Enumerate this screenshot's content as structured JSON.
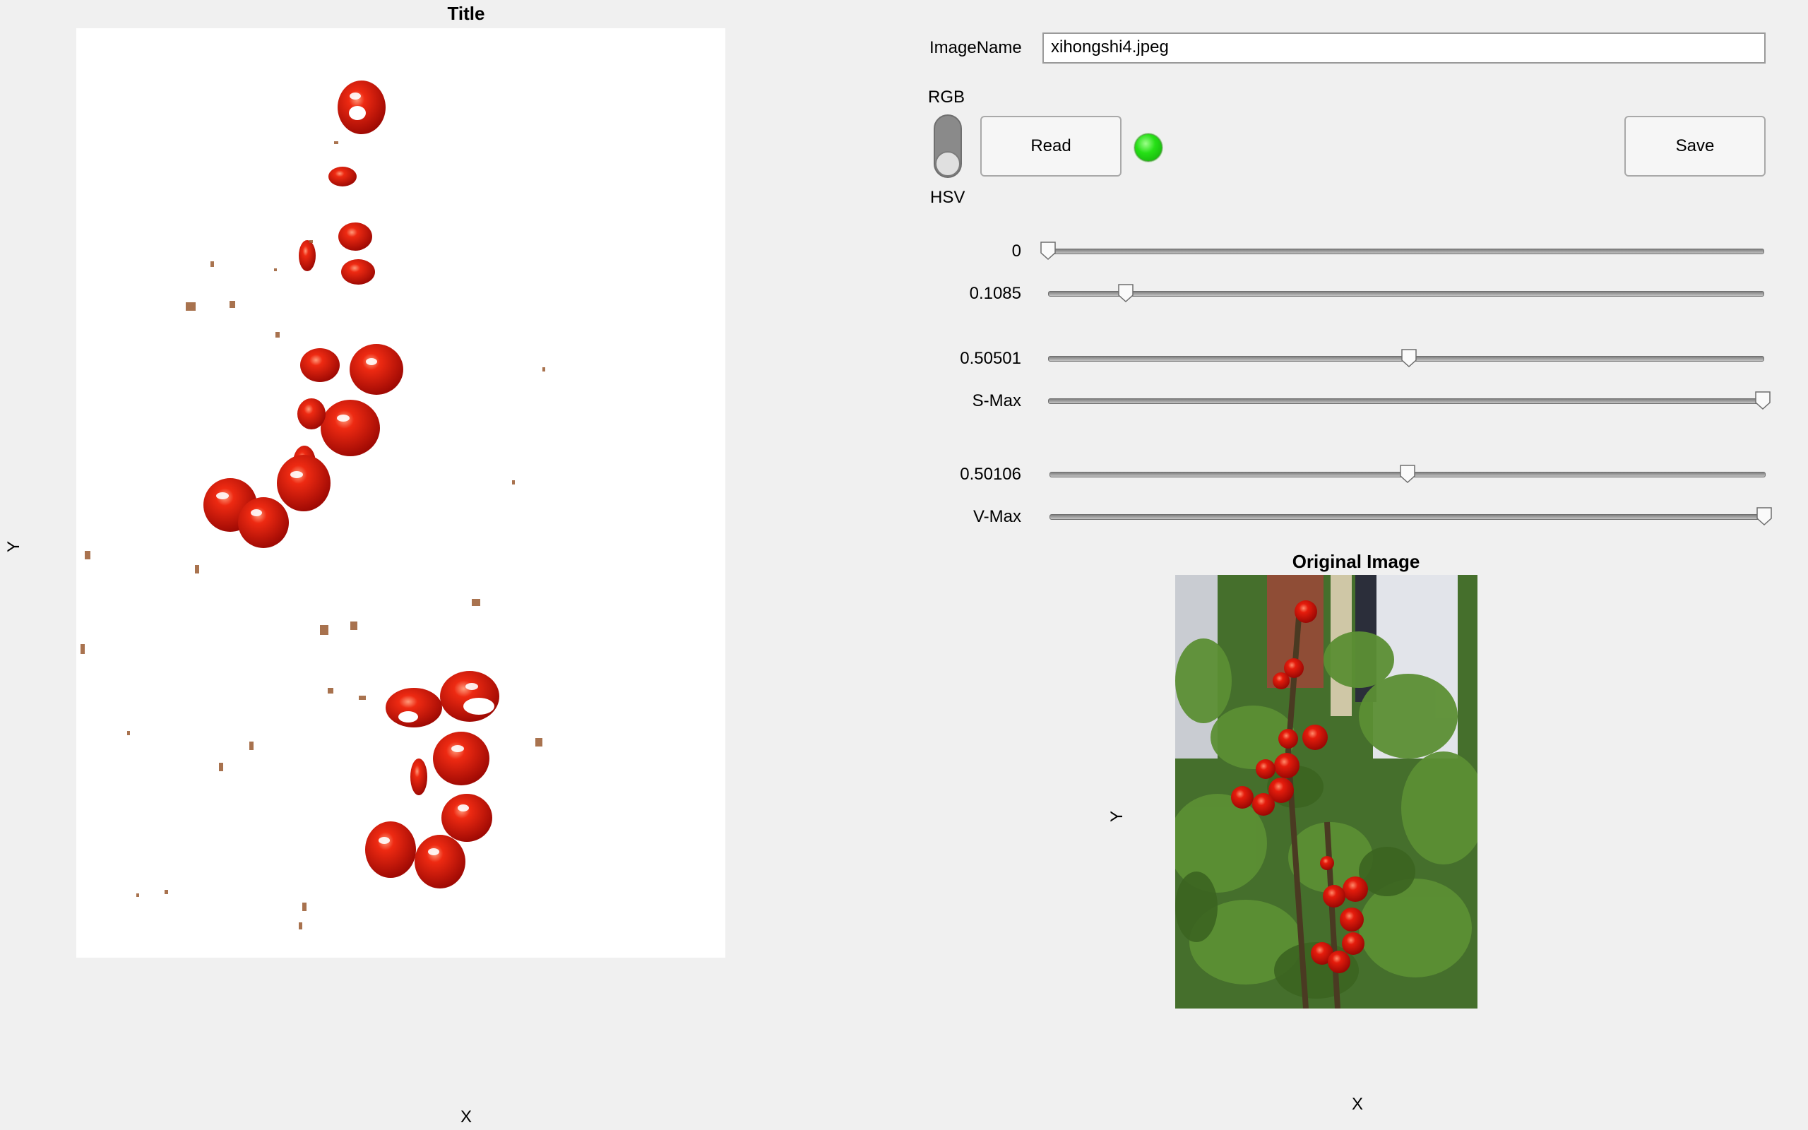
{
  "left_axes": {
    "title": "Title",
    "xlabel": "X",
    "ylabel": "Y"
  },
  "controls": {
    "image_name_label": "ImageName",
    "image_name_value": "xihongshi4.jpeg",
    "toggle_top_label": "RGB",
    "toggle_bottom_label": "HSV",
    "toggle_state": "HSV",
    "read_button": "Read",
    "save_button": "Save",
    "lamp_color": "#22dd11"
  },
  "sliders": [
    {
      "label": "0",
      "value": 0.0
    },
    {
      "label": "0.1085",
      "value": 0.1085
    },
    {
      "label": "0.50501",
      "value": 0.50501
    },
    {
      "label": "S-Max",
      "value": 1.0
    },
    {
      "label": "0.50106",
      "value": 0.50106
    },
    {
      "label": "V-Max",
      "value": 1.0
    }
  ],
  "right_axes": {
    "title": "Original Image",
    "xlabel": "X",
    "ylabel": "Y"
  },
  "colors": {
    "tomato_red": "#d0140a",
    "leaf_green": "#3a6a22",
    "brick": "#8a4a32",
    "window_background": "#f0f0f0"
  }
}
